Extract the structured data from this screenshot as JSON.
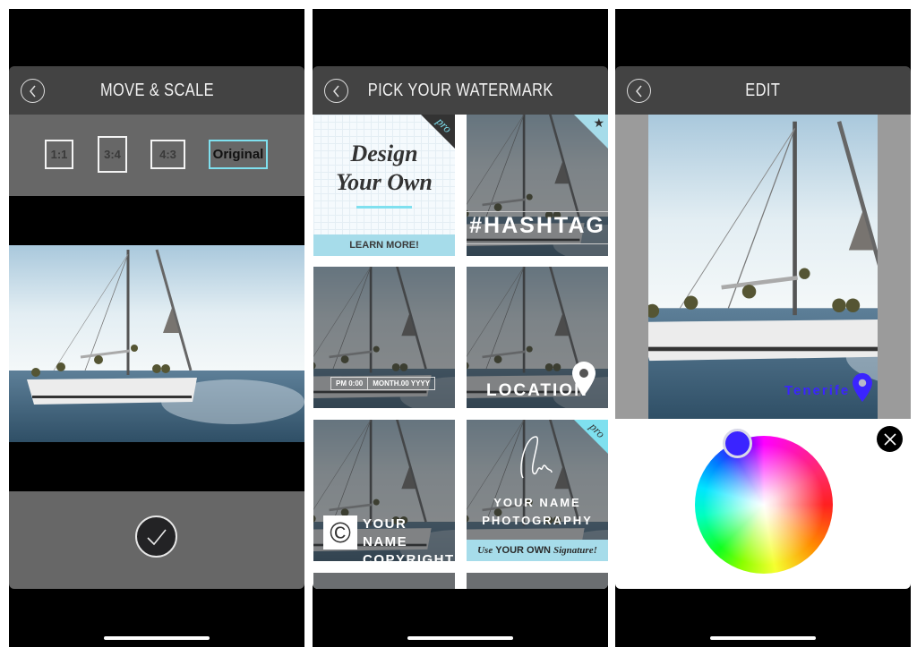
{
  "screens": [
    {
      "header": {
        "title": "MOVE & SCALE",
        "back_icon": "chevron-left-icon"
      },
      "ratios": [
        {
          "label": "1:1",
          "selected": false
        },
        {
          "label": "3:4",
          "selected": false
        },
        {
          "label": "4:3",
          "selected": false
        },
        {
          "label": "Original",
          "selected": true
        }
      ],
      "confirm_icon": "checkmark-icon"
    },
    {
      "header": {
        "title": "PICK YOUR WATERMARK",
        "back_icon": "chevron-left-icon"
      },
      "tiles": [
        {
          "title_line1": "Design",
          "title_line2": "Your Own",
          "cta": "LEARN MORE!",
          "badge": "pro"
        },
        {
          "text": "#HASHTAG",
          "badge": "star-icon"
        },
        {
          "time": "PM 0:00",
          "date": "MONTH.00 YYYY"
        },
        {
          "text": "LOCATION",
          "icon": "map-pin-icon"
        },
        {
          "line1": "YOUR NAME",
          "line2": "COPYRIGHT",
          "icon": "copyright-icon"
        },
        {
          "line1": "YOUR NAME",
          "line2": "PHOTOGRAPHY",
          "cta_prefix": "Use",
          "cta_bold": "YOUR OWN",
          "cta_suffix": "Signature!",
          "badge": "pro"
        }
      ]
    },
    {
      "header": {
        "title": "EDIT",
        "back_icon": "chevron-left-icon"
      },
      "watermark": {
        "text": "Tenerife",
        "color": "#3a24ff",
        "icon": "map-pin-icon"
      },
      "color_picker": {
        "selected_color": "#3a24ff",
        "close_icon": "close-icon"
      }
    }
  ],
  "colors": {
    "accent": "#7fe0ef",
    "header": "#434343",
    "toolbar": "#676767",
    "tile_banner": "#a6dcea"
  }
}
